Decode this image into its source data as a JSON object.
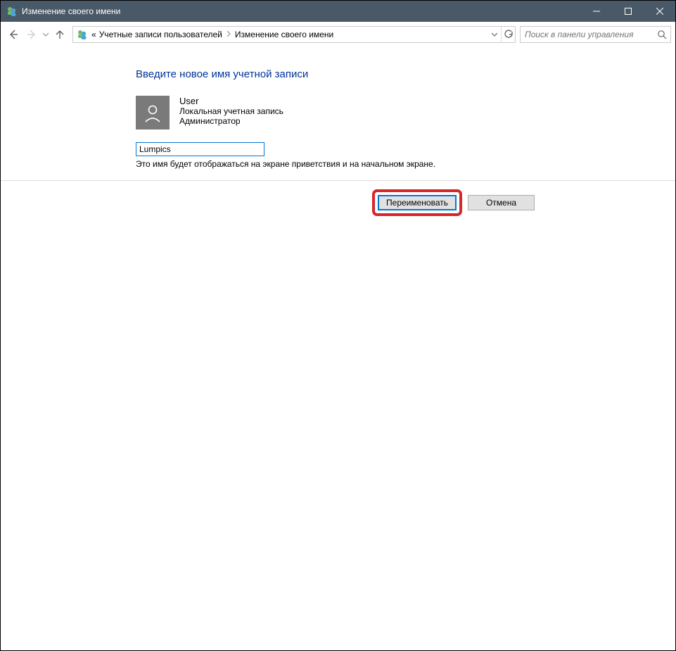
{
  "titlebar": {
    "title": "Изменение своего имени"
  },
  "breadcrumb": {
    "prefix": "«",
    "items": [
      "Учетные записи пользователей",
      "Изменение своего имени"
    ]
  },
  "search": {
    "placeholder": "Поиск в панели управления"
  },
  "page": {
    "heading": "Введите новое имя учетной записи",
    "user": {
      "name": "User",
      "type": "Локальная учетная запись",
      "role": "Администратор"
    },
    "name_input_value": "Lumpics",
    "hint": "Это имя будет отображаться на экране приветствия и на начальном экране."
  },
  "buttons": {
    "rename": "Переименовать",
    "cancel": "Отмена"
  }
}
